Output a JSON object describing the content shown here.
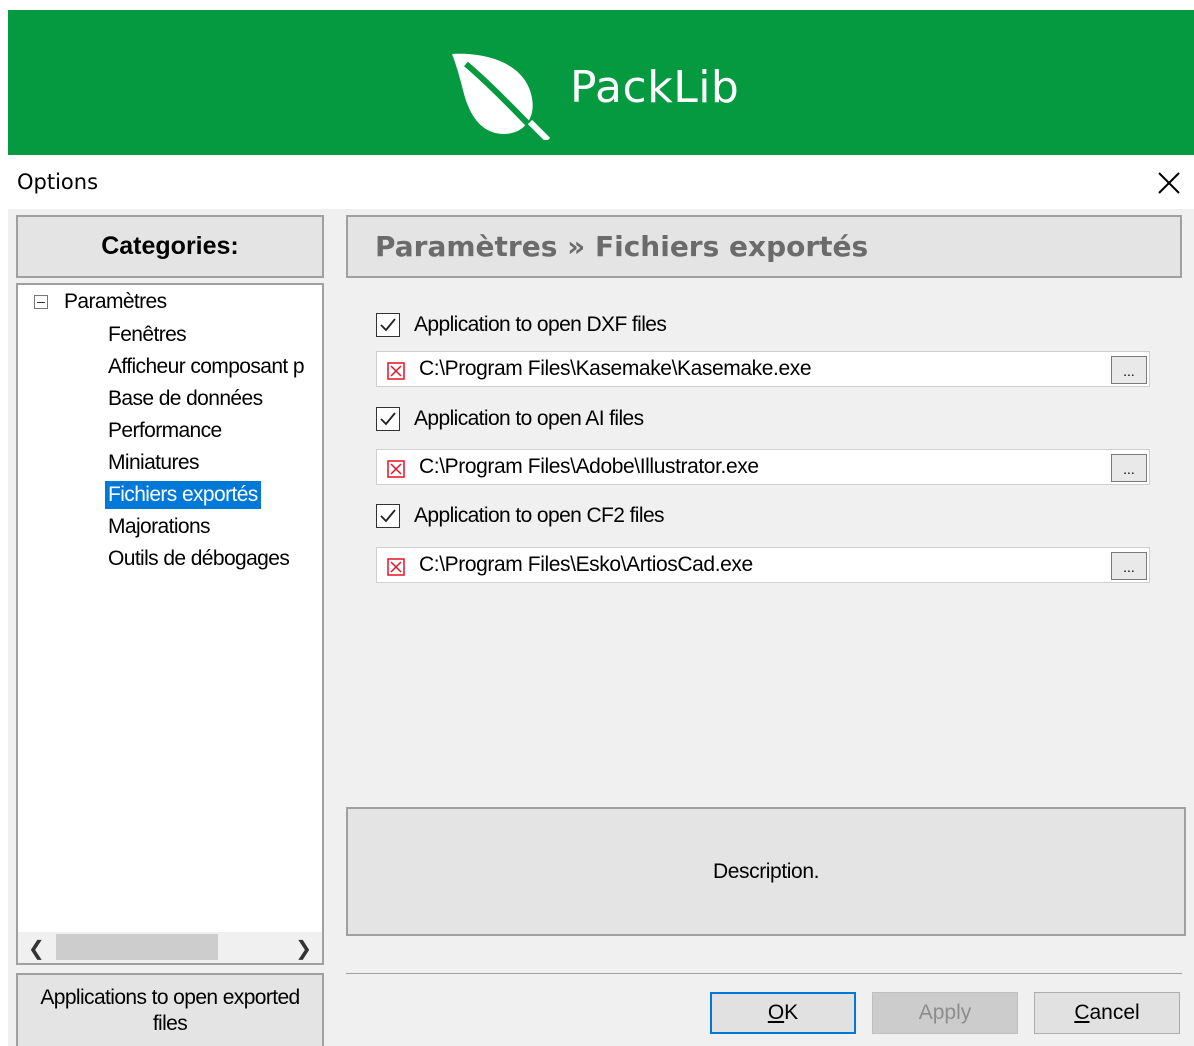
{
  "banner": {
    "brand": "PackLib",
    "color": "#069a40",
    "logo_icon": "leaf-icon"
  },
  "window": {
    "title": "Options",
    "close_icon": "close-icon"
  },
  "categories": {
    "header": "Categories:",
    "root": "Paramètres",
    "items": [
      {
        "label": "Fenêtres"
      },
      {
        "label": "Afficheur composant p"
      },
      {
        "label": "Base de données"
      },
      {
        "label": "Performance"
      },
      {
        "label": "Miniatures"
      },
      {
        "label": "Fichiers exportés",
        "selected": true
      },
      {
        "label": "Majorations"
      },
      {
        "label": "Outils de débogages"
      }
    ],
    "description": "Applications to open exported files"
  },
  "page": {
    "header": "Paramètres » Fichiers exportés",
    "settings": [
      {
        "label": "Application to open DXF files",
        "checked": true,
        "path": "C:\\Program Files\\Kasemake\\Kasemake.exe",
        "browse": "..."
      },
      {
        "label": "Application to open AI files",
        "checked": true,
        "path": "C:\\Program Files\\Adobe\\Illustrator.exe",
        "browse": "..."
      },
      {
        "label": "Application to open CF2 files",
        "checked": true,
        "path": "C:\\Program Files\\Esko\\ArtiosCad.exe",
        "browse": "..."
      }
    ],
    "description": "Description."
  },
  "buttons": {
    "ok_first": "O",
    "ok_rest": "K",
    "apply": "Apply",
    "cancel_first": "C",
    "cancel_rest": "ancel"
  }
}
